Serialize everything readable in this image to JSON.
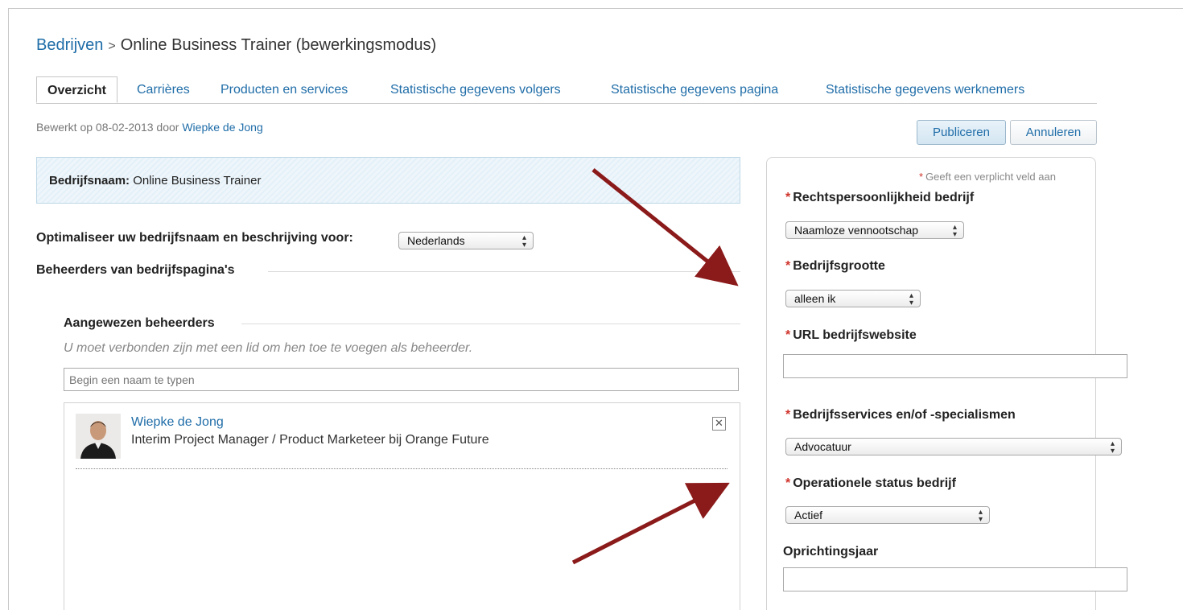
{
  "breadcrumb": {
    "parent": "Bedrijven",
    "separator": ">",
    "current": "Online Business Trainer (bewerkingsmodus)"
  },
  "tabs": [
    {
      "label": "Overzicht",
      "active": true
    },
    {
      "label": "Carrières"
    },
    {
      "label": "Producten en services"
    },
    {
      "label": "Statistische gegevens volgers"
    },
    {
      "label": "Statistische gegevens pagina"
    },
    {
      "label": "Statistische gegevens werknemers"
    }
  ],
  "edited": {
    "prefix": "Bewerkt op 08-02-2013 door",
    "user": "Wiepke de Jong"
  },
  "actions": {
    "publish": "Publiceren",
    "cancel": "Annuleren"
  },
  "company": {
    "label": "Bedrijfsnaam:",
    "value": "Online Business Trainer"
  },
  "optimize": {
    "label": "Optimaliseer uw bedrijfsnaam en beschrijving voor:",
    "selected": "Nederlands"
  },
  "admins_section": {
    "title": "Beheerders van bedrijfspagina's",
    "assigned_title": "Aangewezen beheerders",
    "hint": "U moet verbonden zijn met een lid om hen toe te voegen als beheerder.",
    "input_placeholder": "Begin een naam te typen",
    "admins": [
      {
        "name": "Wiepke de Jong",
        "role": "Interim Project Manager / Product Marketeer bij Orange Future"
      }
    ]
  },
  "form": {
    "required_marker": "*",
    "required_note": "Geeft een verplicht veld aan",
    "legal_entity": {
      "label": "Rechtspersoonlijkheid bedrijf",
      "selected": "Naamloze vennootschap"
    },
    "company_size": {
      "label": "Bedrijfsgrootte",
      "selected": "alleen ik"
    },
    "website": {
      "label": "URL bedrijfswebsite",
      "value": ""
    },
    "specialties": {
      "label": "Bedrijfsservices en/of -specialismen",
      "selected": "Advocatuur"
    },
    "operating_status": {
      "label": "Operationele status bedrijf",
      "selected": "Actief"
    },
    "founded": {
      "label": "Oprichtingsjaar",
      "value": ""
    }
  },
  "colors": {
    "link": "#1f6da8",
    "annotation_arrow": "#8b1a1a",
    "required_star": "#d0342c"
  }
}
